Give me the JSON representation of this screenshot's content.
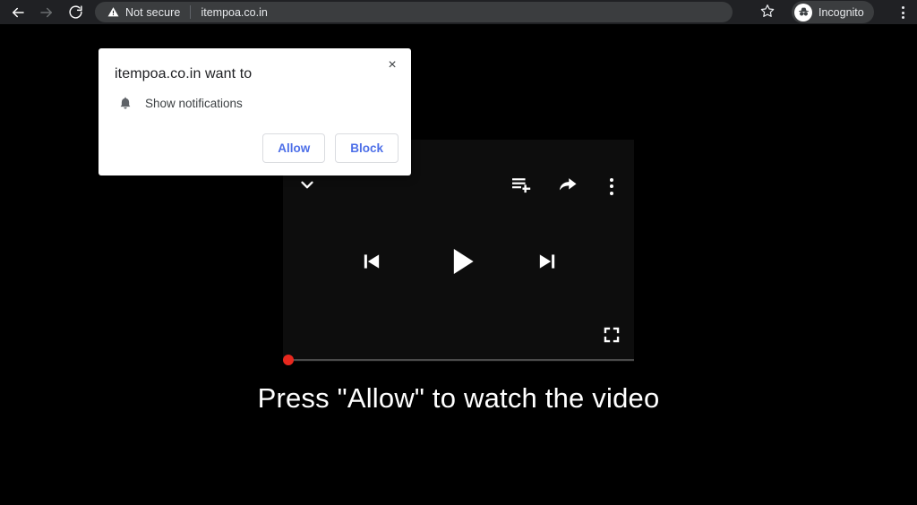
{
  "browser": {
    "back_icon": "arrow-left-icon",
    "forward_icon": "arrow-right-icon",
    "reload_icon": "reload-icon",
    "security_warning_icon": "warning-triangle-icon",
    "security_label": "Not secure",
    "url": "itempoa.co.in",
    "bookmark_icon": "star-icon",
    "incognito_icon": "incognito-spy-icon",
    "incognito_label": "Incognito",
    "menu_icon": "three-dots-vertical-icon",
    "colors": {
      "toolbar_bg": "#202124",
      "omnibox_bg": "#3b3d3f",
      "toolbar_text": "#e8eaed"
    }
  },
  "permission_dialog": {
    "title": "itempoa.co.in want to",
    "close_icon": "close-icon",
    "close_label": "×",
    "permission_icon": "bell-icon",
    "permission_label": "Show notifications",
    "allow_label": "Allow",
    "block_label": "Block",
    "colors": {
      "background": "#ffffff",
      "button_text": "#4d6fe8",
      "button_border": "#dadce0",
      "title_text": "#202124"
    }
  },
  "player": {
    "collapse_icon": "chevron-down-icon",
    "playlist_add_icon": "playlist-add-icon",
    "share_icon": "share-arrow-icon",
    "more_icon": "three-dots-vertical-icon",
    "previous_icon": "skip-previous-icon",
    "play_icon": "play-icon",
    "next_icon": "skip-next-icon",
    "fullscreen_icon": "fullscreen-icon",
    "progress_percent": 0,
    "colors": {
      "panel_bg": "#0d0d0d",
      "control_color": "#ffffff",
      "progress_track": "#4a4a4a",
      "progress_thumb": "#e8281e"
    }
  },
  "page": {
    "headline": "Press \"Allow\" to watch the video",
    "background": "#000000",
    "text_color": "#ffffff"
  }
}
